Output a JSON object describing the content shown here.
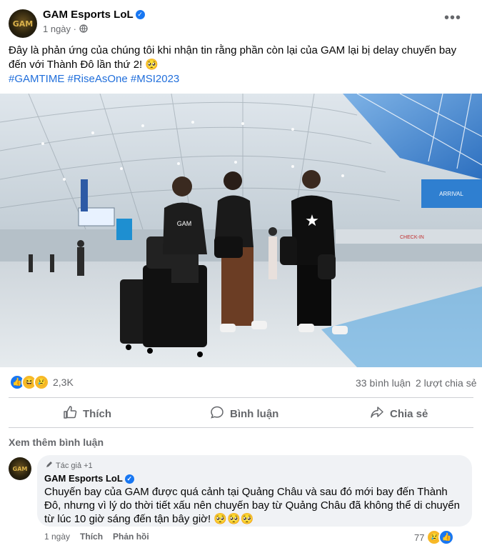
{
  "post": {
    "author": "GAM Esports LoL",
    "time": "1 ngày",
    "globe_icon": "globe-icon",
    "more_icon": "more-options-icon",
    "text": "Đây là phản ứng của chúng tôi khi nhận tin rằng phần còn lại của GAM lại bị delay chuyến bay đến với Thành Đô lần thứ 2! 🥺",
    "hashtags": "#GAMTIME #RiseAsOne #MSI2023",
    "avatar_logo": "GAM"
  },
  "photo": {
    "signs": [
      "ARRIVAL",
      "CHECK-IN"
    ]
  },
  "stats": {
    "reaction_count": "2,3K",
    "comments": "33 bình luận",
    "shares": "2 lượt chia sẻ",
    "reaction_icons": [
      "like-icon",
      "haha-icon",
      "sad-icon"
    ]
  },
  "actions": {
    "like": "Thích",
    "comment": "Bình luận",
    "share": "Chia sẻ"
  },
  "comments_section": {
    "more_comments": "Xem thêm bình luận",
    "comment": {
      "badge": "Tác giả +1",
      "author": "GAM Esports LoL",
      "text": "Chuyến bay của GAM được quá cảnh tại Quảng Châu và sau đó mới bay đến Thành Đô, nhưng vì lý do thời tiết xấu nên chuyến bay từ Quảng Châu đã không thể di chuyển từ lúc 10 giờ sáng đến tận bây giờ! 🥺🥺🥺",
      "time": "1 ngày",
      "like": "Thích",
      "reply": "Phản hồi",
      "reaction_count": "77"
    }
  }
}
